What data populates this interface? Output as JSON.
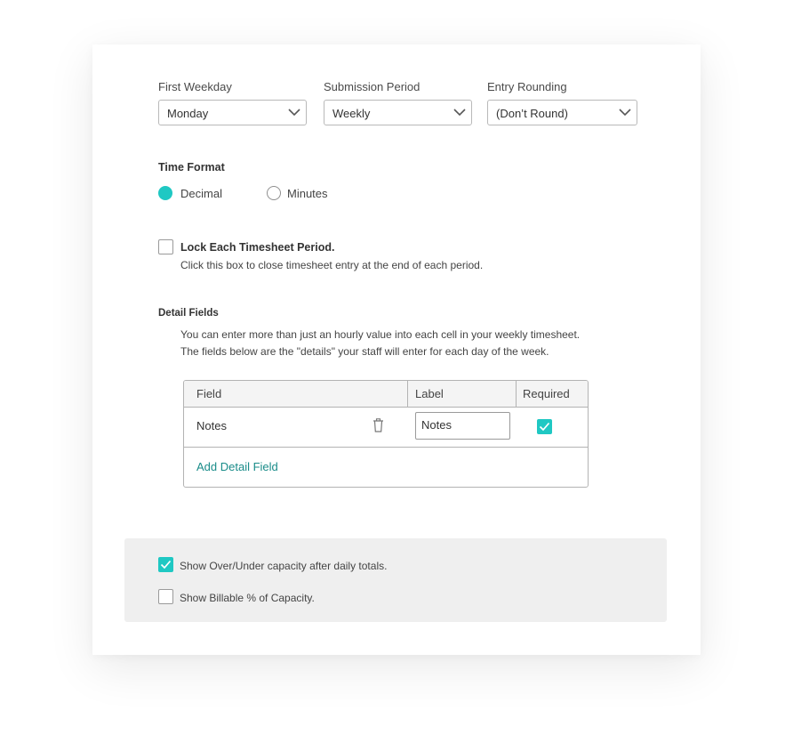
{
  "selects": [
    {
      "label": "First Weekday",
      "value": "Monday"
    },
    {
      "label": "Submission Period",
      "value": "Weekly"
    },
    {
      "label": "Entry Rounding",
      "value": "(Don’t Round)"
    }
  ],
  "time_format": {
    "title": "Time Format",
    "options": [
      {
        "label": "Decimal",
        "selected": true
      },
      {
        "label": "Minutes",
        "selected": false
      }
    ]
  },
  "lock_period": {
    "title": "Lock Each Timesheet Period.",
    "description": "Click this box to close timesheet entry at the end of each period.",
    "checked": false
  },
  "detail_fields": {
    "title": "Detail Fields",
    "description_line1": "You can enter more than just an hourly value into each cell in your weekly timesheet.",
    "description_line2": "The fields below are the \"details\" your staff will enter for each day of the week.",
    "columns": [
      "Field",
      "Label",
      "Required"
    ],
    "rows": [
      {
        "field": "Notes",
        "label": "Notes",
        "required": true
      }
    ],
    "add_label": "Add Detail Field"
  },
  "options": [
    {
      "label": "Show Over/Under capacity after daily totals.",
      "checked": true
    },
    {
      "label": "Show Billable % of Capacity.",
      "checked": false
    }
  ],
  "colors": {
    "accent": "#1fc8c3",
    "link": "#1a8c89",
    "footer_bg": "#efefef"
  },
  "icons": {
    "select_arrow": "chevron-down-icon",
    "delete": "trash-icon",
    "check": "checkmark-icon"
  }
}
